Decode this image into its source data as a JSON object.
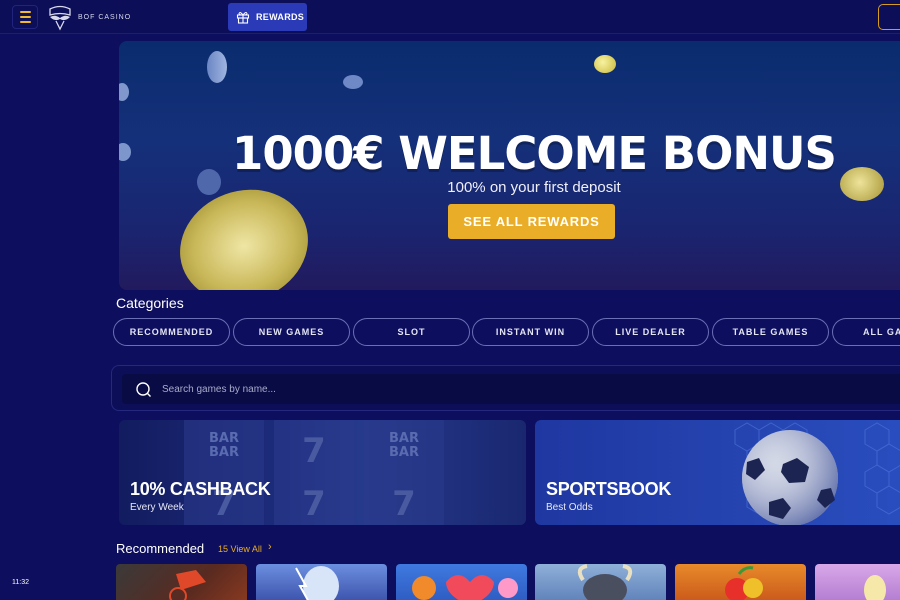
{
  "header": {
    "logo_text": "BOF CASINO",
    "rewards_label": "REWARDS"
  },
  "hero": {
    "title": "1000€ WELCOME BONUS",
    "subtitle": "100% on your first deposit",
    "cta_label": "SEE ALL REWARDS"
  },
  "categories": {
    "title": "Categories",
    "items": [
      "RECOMMENDED",
      "NEW GAMES",
      "SLOT",
      "INSTANT WIN",
      "LIVE DEALER",
      "TABLE GAMES",
      "ALL GAMES"
    ]
  },
  "search": {
    "placeholder": "Search games by name..."
  },
  "promos": [
    {
      "title": "10% CASHBACK",
      "subtitle": "Every Week"
    },
    {
      "title": "SPORTSBOOK",
      "subtitle": "Best Odds"
    }
  ],
  "recommended": {
    "title": "Recommended",
    "view_all": "15 View All"
  },
  "status": {
    "time": "11:32"
  },
  "colors": {
    "background": "#0d0f5e",
    "accent": "#e9ad27",
    "rewards_button": "#2b3ab7",
    "chip_border": "#6b6fb6"
  }
}
